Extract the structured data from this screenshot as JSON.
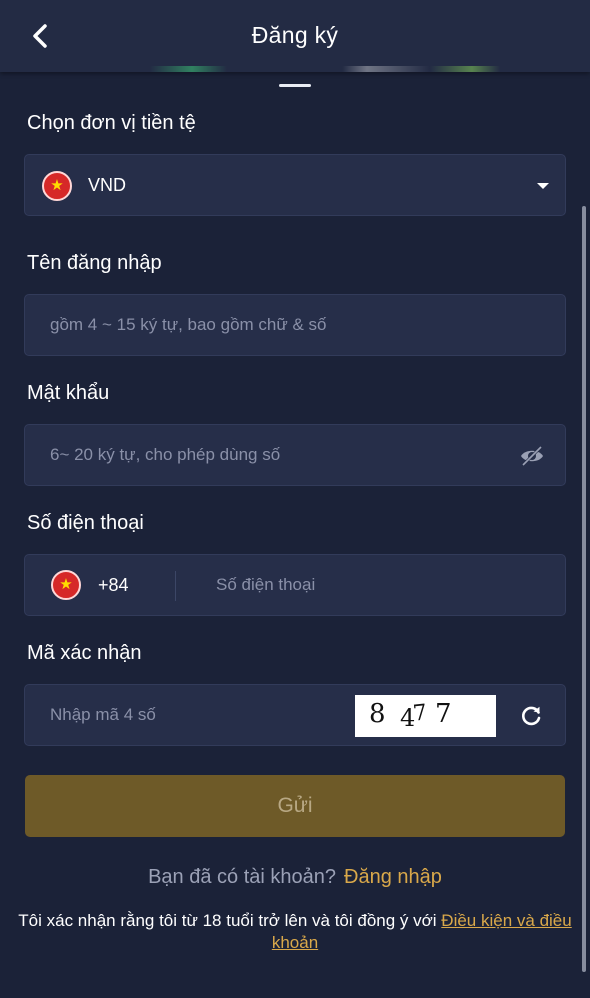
{
  "header": {
    "title": "Đăng ký"
  },
  "currency": {
    "label": "Chọn đơn vị tiền tệ",
    "value": "VND"
  },
  "username": {
    "label": "Tên đăng nhập",
    "placeholder": "gồm 4 ~ 15 ký tự, bao gồm chữ & số"
  },
  "password": {
    "label": "Mật khẩu",
    "placeholder": "6~ 20 ký tự, cho phép dùng số"
  },
  "phone": {
    "label": "Số điện thoại",
    "code": "+84",
    "placeholder": "Số điện thoại"
  },
  "verify": {
    "label": "Mã xác nhận",
    "placeholder": "Nhập mã 4 số",
    "captcha": [
      "8",
      "4",
      "7",
      "7"
    ]
  },
  "submit": {
    "label": "Gửi"
  },
  "login": {
    "question": "Bạn đã có tài khoản?",
    "link": "Đăng nhập"
  },
  "terms": {
    "text": "Tôi xác nhận rằng tôi từ 18 tuổi trở lên và tôi đồng ý với ",
    "link": "Điều kiện và điều khoản"
  },
  "colors": {
    "background": "#1b2238",
    "field": "#262e49",
    "accent": "#d9a84a",
    "button": "#6e5a28",
    "flag": "#d62828"
  }
}
